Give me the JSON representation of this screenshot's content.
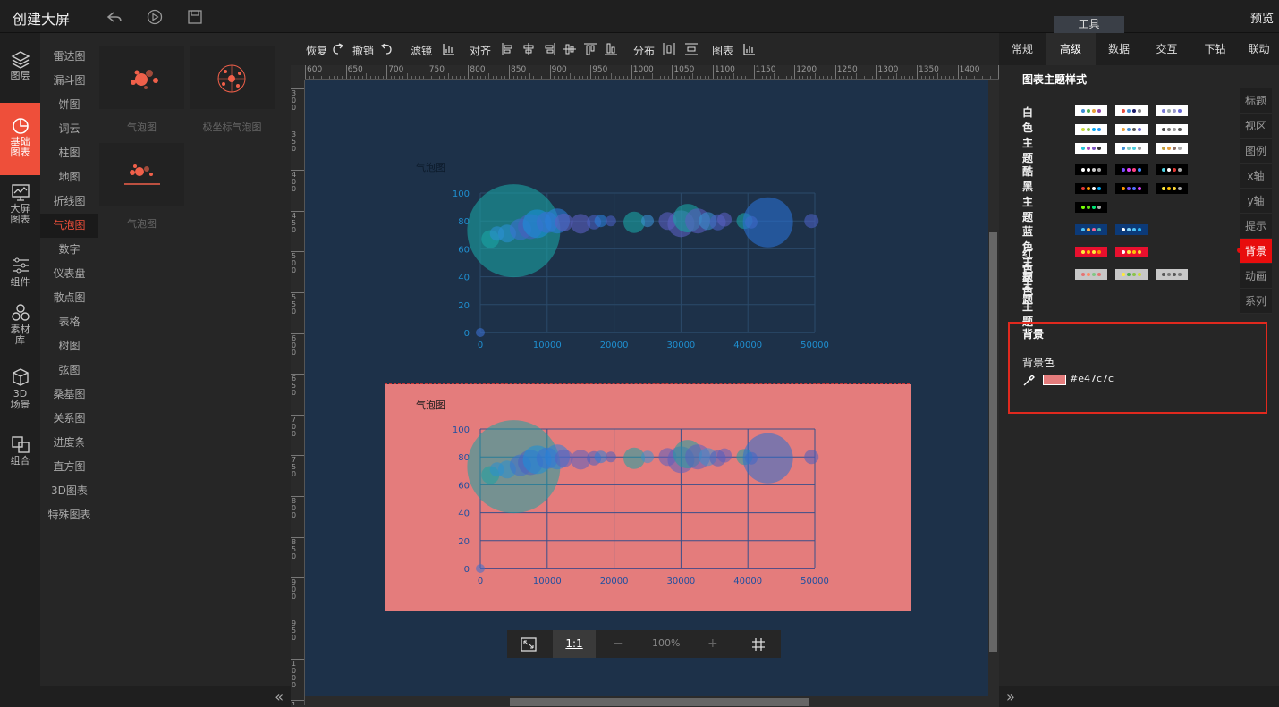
{
  "app": {
    "title": "创建大屏",
    "preview_label": "预览",
    "tools_label": "工具"
  },
  "leftnav": [
    {
      "label": "图层",
      "icon": "layers-icon"
    },
    {
      "label": "基础图表",
      "icon": "pie-chart-icon",
      "active": true
    },
    {
      "label": "大屏图表",
      "icon": "monitor-chart-icon"
    },
    {
      "label": "组件",
      "icon": "sliders-icon"
    },
    {
      "label": "素材库",
      "icon": "hexagons-icon"
    },
    {
      "label": "3D场景",
      "icon": "cube-icon"
    },
    {
      "label": "组合",
      "icon": "combine-icon"
    }
  ],
  "categories": [
    "雷达图",
    "漏斗图",
    "饼图",
    "词云",
    "柱图",
    "地图",
    "折线图",
    "气泡图",
    "数字",
    "仪表盘",
    "散点图",
    "表格",
    "树图",
    "弦图",
    "桑基图",
    "关系图",
    "进度条",
    "直方图",
    "3D图表",
    "特殊图表"
  ],
  "active_category": "气泡图",
  "thumbnails": [
    "气泡图",
    "极坐标气泡图",
    "气泡图"
  ],
  "toolbar": {
    "redo": "恢复",
    "undo": "撤销",
    "filter": "滤镜",
    "align": "对齐",
    "distribute": "分布",
    "chart": "图表"
  },
  "ruler": {
    "h_ticks": [
      "600",
      "650",
      "700",
      "750",
      "800",
      "850",
      "900",
      "950",
      "1000",
      "1050",
      "1100",
      "1150",
      "1200",
      "1250",
      "1300",
      "1350",
      "1400",
      "14"
    ],
    "v_ticks": [
      "300",
      "350",
      "400",
      "450",
      "500",
      "550",
      "600",
      "650",
      "700",
      "750",
      "800",
      "850",
      "900",
      "950",
      "1000",
      "1"
    ]
  },
  "zoom": {
    "fit_label": "1:1",
    "minus": "−",
    "value": "100%",
    "plus": "+"
  },
  "right_tabs": [
    "常规",
    "高级",
    "数据",
    "交互",
    "下钻",
    "联动"
  ],
  "active_right_tab": "高级",
  "theme_section": {
    "title": "图表主题样式",
    "groups": [
      {
        "label": "白色主题",
        "bg": "#ffffff",
        "rows": 3
      },
      {
        "label": "酷黑主题",
        "bg": "#000000",
        "rows": 3
      },
      {
        "label": "蓝色主题",
        "bg": "#0c3a78",
        "rows": 1
      },
      {
        "label": "红色主题",
        "bg": "#e8102e",
        "rows": 1
      },
      {
        "label": "灰色主题",
        "bg": "#c8c8c8",
        "rows": 1
      }
    ]
  },
  "side_tabs": [
    "标题",
    "视区",
    "图例",
    "x轴",
    "y轴",
    "提示",
    "背景",
    "动画",
    "系列"
  ],
  "active_side_tab": "背景",
  "background_section": {
    "title": "背景",
    "color_label": "背景色",
    "color_value": "#e47c7c"
  },
  "chart_data": [
    {
      "type": "scatter",
      "title": "气泡图",
      "xlim": [
        0,
        50000
      ],
      "ylim": [
        0,
        100
      ],
      "x_ticks": [
        "0",
        "10000",
        "20000",
        "30000",
        "40000",
        "50000"
      ],
      "y_ticks": [
        "0",
        "20",
        "40",
        "60",
        "80",
        "100"
      ],
      "background": "transparent",
      "grid": true,
      "points": [
        {
          "x": 5000,
          "y": 73,
          "r": 52,
          "color": "#1aa3a3"
        },
        {
          "x": 1500,
          "y": 67,
          "r": 10,
          "color": "#1aa3a3"
        },
        {
          "x": 2500,
          "y": 71,
          "r": 8,
          "color": "#2a8fd0"
        },
        {
          "x": 4000,
          "y": 71,
          "r": 10,
          "color": "#2a8fd0"
        },
        {
          "x": 6000,
          "y": 74,
          "r": 12,
          "color": "#3b6fd0"
        },
        {
          "x": 7500,
          "y": 76,
          "r": 14,
          "color": "#4a5fc0"
        },
        {
          "x": 8500,
          "y": 78,
          "r": 16,
          "color": "#1a8fd8"
        },
        {
          "x": 10000,
          "y": 79,
          "r": 12,
          "color": "#3b6fd0"
        },
        {
          "x": 11500,
          "y": 80,
          "r": 14,
          "color": "#2a7fd8"
        },
        {
          "x": 12500,
          "y": 79,
          "r": 10,
          "color": "#5a5fc0"
        },
        {
          "x": 15000,
          "y": 78,
          "r": 11,
          "color": "#5a5fc0"
        },
        {
          "x": 17000,
          "y": 79,
          "r": 8,
          "color": "#4a5fc0"
        },
        {
          "x": 18000,
          "y": 80,
          "r": 7,
          "color": "#2a7fd8"
        },
        {
          "x": 19500,
          "y": 80,
          "r": 6,
          "color": "#4a5fc0"
        },
        {
          "x": 23000,
          "y": 79,
          "r": 12,
          "color": "#1aa3a3"
        },
        {
          "x": 25000,
          "y": 80,
          "r": 7,
          "color": "#3b8fd0"
        },
        {
          "x": 28000,
          "y": 80,
          "r": 10,
          "color": "#5a5fc0"
        },
        {
          "x": 30000,
          "y": 78,
          "r": 15,
          "color": "#5a5fc0"
        },
        {
          "x": 31000,
          "y": 82,
          "r": 16,
          "color": "#1aa3a3"
        },
        {
          "x": 32500,
          "y": 80,
          "r": 14,
          "color": "#5a5fc0"
        },
        {
          "x": 34000,
          "y": 80,
          "r": 10,
          "color": "#3b8fd0"
        },
        {
          "x": 35500,
          "y": 79,
          "r": 9,
          "color": "#4a5fc0"
        },
        {
          "x": 36500,
          "y": 81,
          "r": 8,
          "color": "#5a5fc0"
        },
        {
          "x": 39500,
          "y": 80,
          "r": 9,
          "color": "#1aa3a3"
        },
        {
          "x": 40500,
          "y": 79,
          "r": 7,
          "color": "#5a5fc0"
        },
        {
          "x": 43000,
          "y": 79,
          "r": 28,
          "color": "#2a6fd0"
        },
        {
          "x": 49500,
          "y": 80,
          "r": 8,
          "color": "#4a5fc0"
        },
        {
          "x": 0,
          "y": 0,
          "r": 5,
          "color": "#3b6fd0"
        }
      ]
    },
    {
      "type": "scatter",
      "title": "气泡图",
      "xlim": [
        0,
        50000
      ],
      "ylim": [
        0,
        100
      ],
      "x_ticks": [
        "0",
        "10000",
        "20000",
        "30000",
        "40000",
        "50000"
      ],
      "y_ticks": [
        "0",
        "20",
        "40",
        "60",
        "80",
        "100"
      ],
      "background": "#e47c7c",
      "grid": true
    }
  ]
}
